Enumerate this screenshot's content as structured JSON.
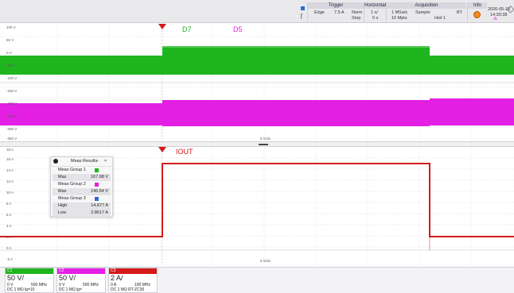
{
  "colors": {
    "ch1": "#1fb51f",
    "ch2": "#e41fe4",
    "ch3": "#d51b1b",
    "trigger_marker": "#d51b1b",
    "d7_label": "#1fb51f",
    "d5_label": "#e41fe4",
    "iout_label": "#d51b1b"
  },
  "topbar": {
    "trigger": {
      "title": "Trigger",
      "type": "Edge",
      "level": "7.5 A",
      "mode": "Norm",
      "state": "Stop"
    },
    "horizontal": {
      "title": "Horizontal",
      "scale": "1 s/",
      "position": "0 s"
    },
    "acquisition": {
      "title": "Acquisition",
      "rate": "1 MSa/s",
      "mode": "Sample",
      "length": "10 Mpts",
      "hist": "Hist 1",
      "bt": "BT"
    },
    "info": {
      "title": "Info",
      "date": "2026-05-15",
      "time": "14:30:38"
    }
  },
  "upper_panel": {
    "labels": {
      "d7": "D7",
      "d5": "D5"
    },
    "scale_left": [
      "-350 V",
      "-300 V",
      "-250 V",
      "-200 V",
      "-150 V",
      "-100 V",
      "-50 V",
      "0 V",
      "50 V",
      "100 V"
    ],
    "axis_mark": "5 Gdiv"
  },
  "lower_panel": {
    "labels": {
      "iout": "IOUT"
    },
    "scale_left": [
      "18 A",
      "16 A",
      "14 A",
      "12 A",
      "10 A",
      "8 A",
      "6 A",
      "4 A",
      "2 A",
      "0 A",
      "-2 A"
    ],
    "axis_mark": "5 Gdiv"
  },
  "meas_results": {
    "title": "Meas Results",
    "minimize": "–",
    "close": "×",
    "groups": [
      {
        "name": "Meas Group 1",
        "color": "#1fb51f",
        "rows": [
          {
            "label": "Max",
            "value": "167.98 V"
          }
        ]
      },
      {
        "name": "Meas Group 2",
        "color": "#e41fe4",
        "rows": [
          {
            "label": "Max",
            "value": "146.64 V"
          }
        ]
      },
      {
        "name": "Meas Group 3",
        "color": "#2d6bd6",
        "rows": [
          {
            "label": "High",
            "value": "14.877 A"
          },
          {
            "label": "Low",
            "value": "2.8617 A"
          }
        ]
      }
    ]
  },
  "channels": [
    {
      "name": "C1",
      "vdiv": "50 V/",
      "offset": "0 V",
      "bw": "500 MHz",
      "coupling": "DC 1 MΩ lg=10",
      "color": "#1fb51f"
    },
    {
      "name": "C2",
      "vdiv": "50 V/",
      "offset": "0 V",
      "bw": "500 MHz",
      "coupling": "DC 1 MΩ lg=",
      "color": "#e41fe4"
    },
    {
      "name": "C3",
      "vdiv": "2 A/",
      "offset": "0 A",
      "bw": "100 MHz",
      "coupling": "DC 1 MΩ  RT-ZC30",
      "color": "#d51b1b"
    }
  ]
}
